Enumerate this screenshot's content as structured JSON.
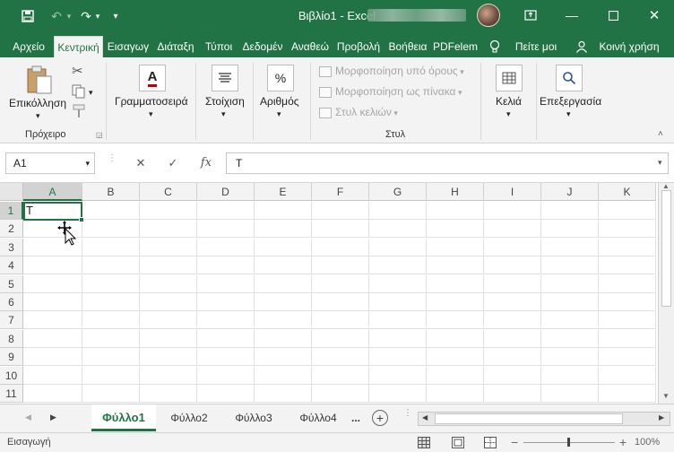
{
  "titlebar": {
    "title": "Βιβλίο1  -  Excel",
    "customize_glyph": "▾"
  },
  "tabs": [
    {
      "label": "Αρχείο"
    },
    {
      "label": "Κεντρική"
    },
    {
      "label": "Εισαγωγ"
    },
    {
      "label": "Διάταξη"
    },
    {
      "label": "Τύποι"
    },
    {
      "label": "Δεδομέν"
    },
    {
      "label": "Αναθεώ"
    },
    {
      "label": "Προβολή"
    },
    {
      "label": "Βοήθεια"
    },
    {
      "label": "PDFelem"
    },
    {
      "label": "Πείτε μοι"
    },
    {
      "label": "Κοινή χρήση"
    }
  ],
  "ribbon": {
    "paste_label": "Επικόλληση",
    "clipboard_group": "Πρόχειρο",
    "font_label": "Γραμματοσειρά",
    "alignment_label": "Στοίχιση",
    "number_label": "Αριθμός",
    "number_icon_text": "%",
    "font_icon_text": "A",
    "conditional_formatting": "Μορφοποίηση υπό όρους",
    "format_as_table": "Μορφοποίηση ως πίνακα",
    "cell_styles": "Στυλ κελιών",
    "styles_group": "Στυλ",
    "cells_label": "Κελιά",
    "editing_label": "Επεξεργασία"
  },
  "formula_bar": {
    "name_box": "A1",
    "cancel": "✕",
    "enter": "✓",
    "fx": "fx",
    "value": "T"
  },
  "grid": {
    "columns": [
      "A",
      "B",
      "C",
      "D",
      "E",
      "F",
      "G",
      "H",
      "I",
      "J",
      "K"
    ],
    "rows": [
      "1",
      "2",
      "3",
      "4",
      "5",
      "6",
      "7",
      "8",
      "9",
      "10",
      "11"
    ],
    "active_cell_value": "T"
  },
  "sheets": {
    "tabs": [
      "Φύλλο1",
      "Φύλλο2",
      "Φύλλο3",
      "Φύλλο4"
    ],
    "more": "...",
    "add": "+"
  },
  "status": {
    "mode": "Εισαγωγή",
    "zoom": "100%",
    "zoom_minus": "−",
    "zoom_plus": "+"
  },
  "colors": {
    "accent": "#217346"
  }
}
